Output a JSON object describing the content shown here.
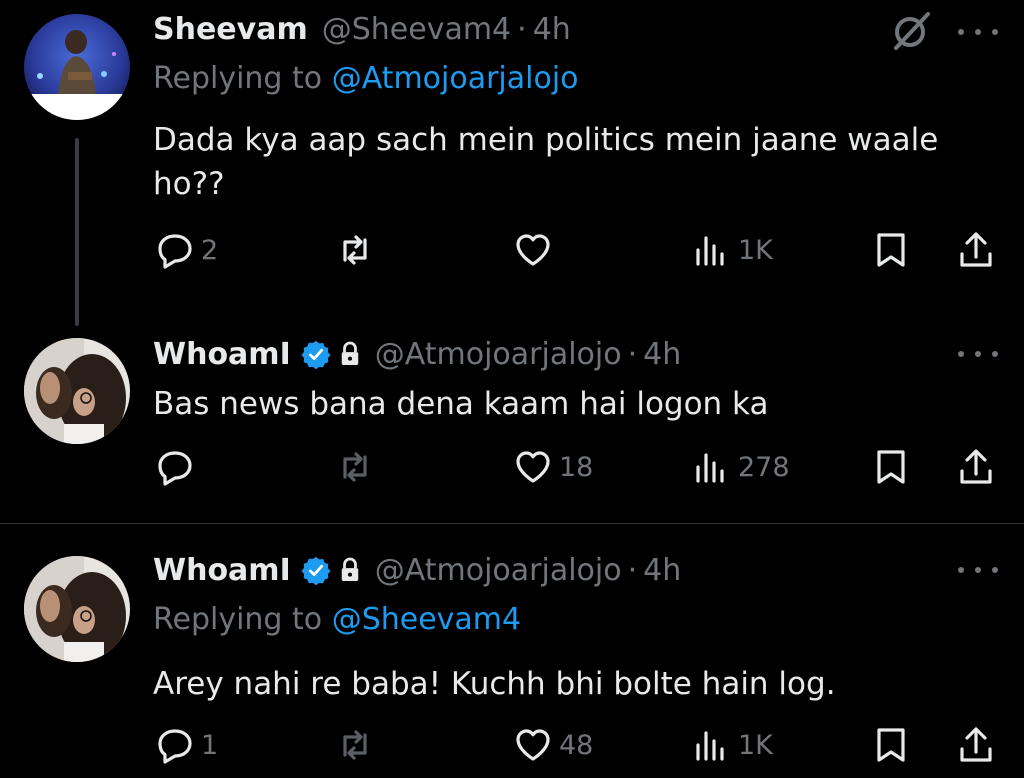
{
  "tweets": [
    {
      "name": "Sheevam",
      "handle": "@Sheevam4",
      "time": "4h",
      "replying_prefix": "Replying to",
      "replying_to": "@Atmojoarjalojo",
      "text": "Dada kya aap sach mein politics mein jaane waale ho??",
      "replies": "2",
      "reposts": "",
      "likes": "",
      "views": "1K"
    },
    {
      "name": "WhoamI",
      "verified": true,
      "protected": true,
      "handle": "@Atmojoarjalojo",
      "time": "4h",
      "text": "Bas news bana dena kaam hai logon ka",
      "replies": "",
      "reposts": "",
      "likes": "18",
      "views": "278"
    },
    {
      "name": "WhoamI",
      "verified": true,
      "protected": true,
      "handle": "@Atmojoarjalojo",
      "time": "4h",
      "replying_prefix": "Replying to",
      "replying_to": "@Sheevam4",
      "text": "Arey nahi re baba! Kuchh bhi bolte hain log.",
      "replies": "1",
      "reposts": "",
      "likes": "48",
      "views": "1K"
    }
  ],
  "separator": "·",
  "icons": {
    "reply": "reply-icon",
    "repost": "repost-icon",
    "like": "heart-icon",
    "views": "views-icon",
    "bookmark": "bookmark-icon",
    "share": "share-icon",
    "more": "more-icon",
    "grok": "grok-icon",
    "verified": "verified-badge-icon",
    "lock": "lock-icon"
  },
  "colors": {
    "background": "#000000",
    "text": "#e7e9ea",
    "muted": "#71767b",
    "accent": "#1d9bf0"
  }
}
